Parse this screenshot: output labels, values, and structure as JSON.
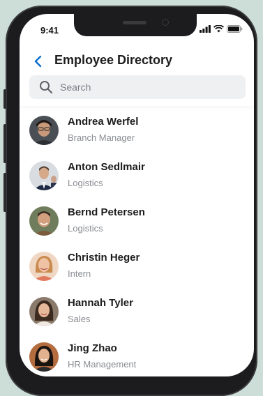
{
  "status_bar": {
    "time": "9:41",
    "icons": [
      "signal-icon",
      "wifi-icon",
      "battery-icon"
    ]
  },
  "header": {
    "back_icon": "chevron-left-icon",
    "title": "Employee Directory"
  },
  "search": {
    "icon": "search-icon",
    "placeholder": "Search"
  },
  "employees": [
    {
      "name": "Andrea Werfel",
      "role": "Branch Manager"
    },
    {
      "name": "Anton Sedlmair",
      "role": "Logistics"
    },
    {
      "name": "Bernd Petersen",
      "role": "Logistics"
    },
    {
      "name": "Christin Heger",
      "role": "Intern"
    },
    {
      "name": "Hannah Tyler",
      "role": "Sales"
    },
    {
      "name": "Jing Zhao",
      "role": "HR Management"
    }
  ],
  "colors": {
    "accent": "#0a6ed1",
    "background": "#cdddd8",
    "text_primary": "#1d1d1f",
    "text_secondary": "#8a8d92"
  }
}
